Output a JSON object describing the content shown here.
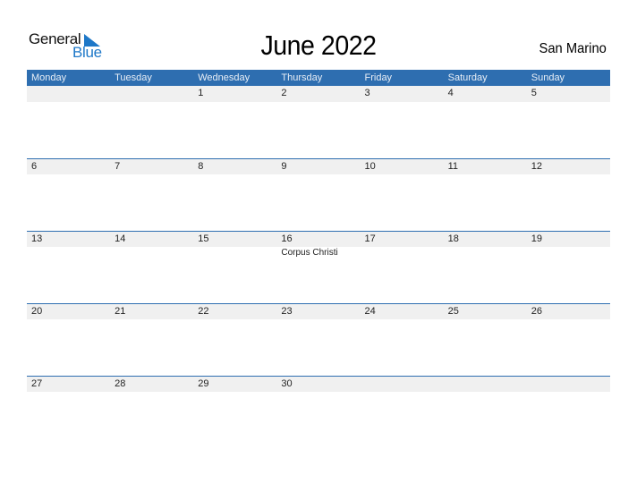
{
  "logo": {
    "general": "General",
    "blue": "Blue",
    "brand_color": "#1e78c8"
  },
  "title": "June 2022",
  "country": "San Marino",
  "header_color": "#2e6eb0",
  "weekdays": [
    "Monday",
    "Tuesday",
    "Wednesday",
    "Thursday",
    "Friday",
    "Saturday",
    "Sunday"
  ],
  "weeks": [
    {
      "days": [
        "",
        "",
        "1",
        "2",
        "3",
        "4",
        "5"
      ],
      "events": [
        "",
        "",
        "",
        "",
        "",
        "",
        ""
      ]
    },
    {
      "days": [
        "6",
        "7",
        "8",
        "9",
        "10",
        "11",
        "12"
      ],
      "events": [
        "",
        "",
        "",
        "",
        "",
        "",
        ""
      ]
    },
    {
      "days": [
        "13",
        "14",
        "15",
        "16",
        "17",
        "18",
        "19"
      ],
      "events": [
        "",
        "",
        "",
        "Corpus Christi",
        "",
        "",
        ""
      ]
    },
    {
      "days": [
        "20",
        "21",
        "22",
        "23",
        "24",
        "25",
        "26"
      ],
      "events": [
        "",
        "",
        "",
        "",
        "",
        "",
        ""
      ]
    },
    {
      "days": [
        "27",
        "28",
        "29",
        "30",
        "",
        "",
        ""
      ],
      "events": [
        "",
        "",
        "",
        "",
        "",
        "",
        ""
      ]
    }
  ]
}
